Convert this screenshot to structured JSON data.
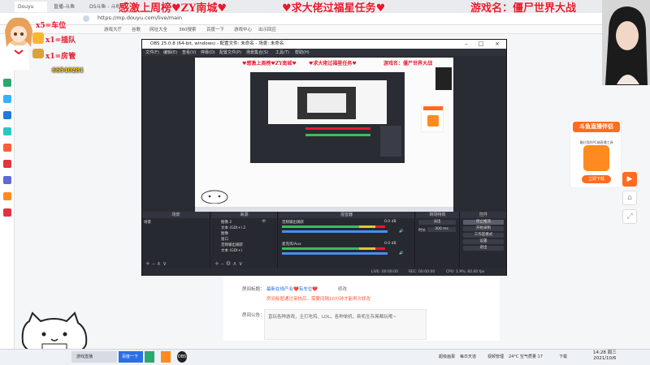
{
  "browser": {
    "tabs": [
      "Douyu",
      "直播-斗鱼",
      "DS斗鱼 - 斗鱼"
    ],
    "url": "https://mp.douyu.com/live/main",
    "bookmarks": [
      "游戏大厅",
      "谷歌",
      "网址大全",
      "360搜索",
      "百度一下",
      "游戏中心",
      "出示回应"
    ]
  },
  "overlay": {
    "top_left": "感激上周榜♥ZY南城♥",
    "top_mid": "♥求大佬过福星任务♥",
    "top_right": "游戏名：僵尸世界大战",
    "left_badges": [
      "x5=车位",
      "x1=插队",
      "x1=房管"
    ],
    "room_number": "66540281"
  },
  "ad": {
    "title": "斗鱼直播伴侣",
    "subtitle": "最好用的PC端直播工具",
    "button": "立即下载"
  },
  "obs": {
    "title": "OBS 25.0.8 (64-bit, windows) - 配置文件: 未命名 - 场景: 未命名",
    "menus": [
      "文件(F)",
      "编辑(E)",
      "查看(V)",
      "停靠(D)",
      "配置文件(P)",
      "场景集合(S)",
      "工具(T)",
      "帮助(H)"
    ],
    "preview_overlay": {
      "left": "♥感激上周榜♥ZY南城♥",
      "mid": "♥求大佬过福星任务♥",
      "right": "游戏名：僵尸世界大战"
    },
    "scenes": {
      "title": "场景",
      "items": [
        "场景"
      ]
    },
    "sources": {
      "title": "来源",
      "items": [
        "图像 2",
        "文本 (GDI+) 2",
        "图像",
        "窗口",
        "音频输出捕获",
        "文本 (GDI+)"
      ]
    },
    "mixer": {
      "title": "混音器",
      "channels": [
        {
          "name": "音频输出捕获",
          "db": "0.0 dB"
        },
        {
          "name": "麦克风/Aux",
          "db": "0.0 dB"
        }
      ]
    },
    "transitions": {
      "title": "转场特效",
      "type": "淡出",
      "duration_label": "时长",
      "duration": "300 ms"
    },
    "controls": {
      "title": "控件",
      "buttons": [
        "停止推流",
        "开始录制",
        "工作室模式",
        "设置",
        "退出"
      ]
    },
    "status": {
      "live": "LIVE: 00:00:00",
      "rec": "REC: 00:00:00",
      "cpu": "CPU: 1.9%, 60.00 fps"
    }
  },
  "page": {
    "title_label": "房间标题：",
    "room_title": "最新在线产业❤️有车位❤️",
    "modify": "修改",
    "hint": "房间标题通过审核后，需要间隔10分钟才能再次修改",
    "announce_label": "房间公告：",
    "announce": "直玩各种游戏，主打吃鸡、LOL，各种单机，新机生存屌都玩哦~"
  },
  "taskbar": {
    "items": [
      "游戏直播",
      "百度一下",
      "OBS"
    ],
    "tray": [
      "超级画报",
      "每日天道",
      "视频管理",
      "下载"
    ],
    "weather": "24°C 空气质量 17",
    "time": "14:28 周三",
    "date": "2021/10/6"
  }
}
